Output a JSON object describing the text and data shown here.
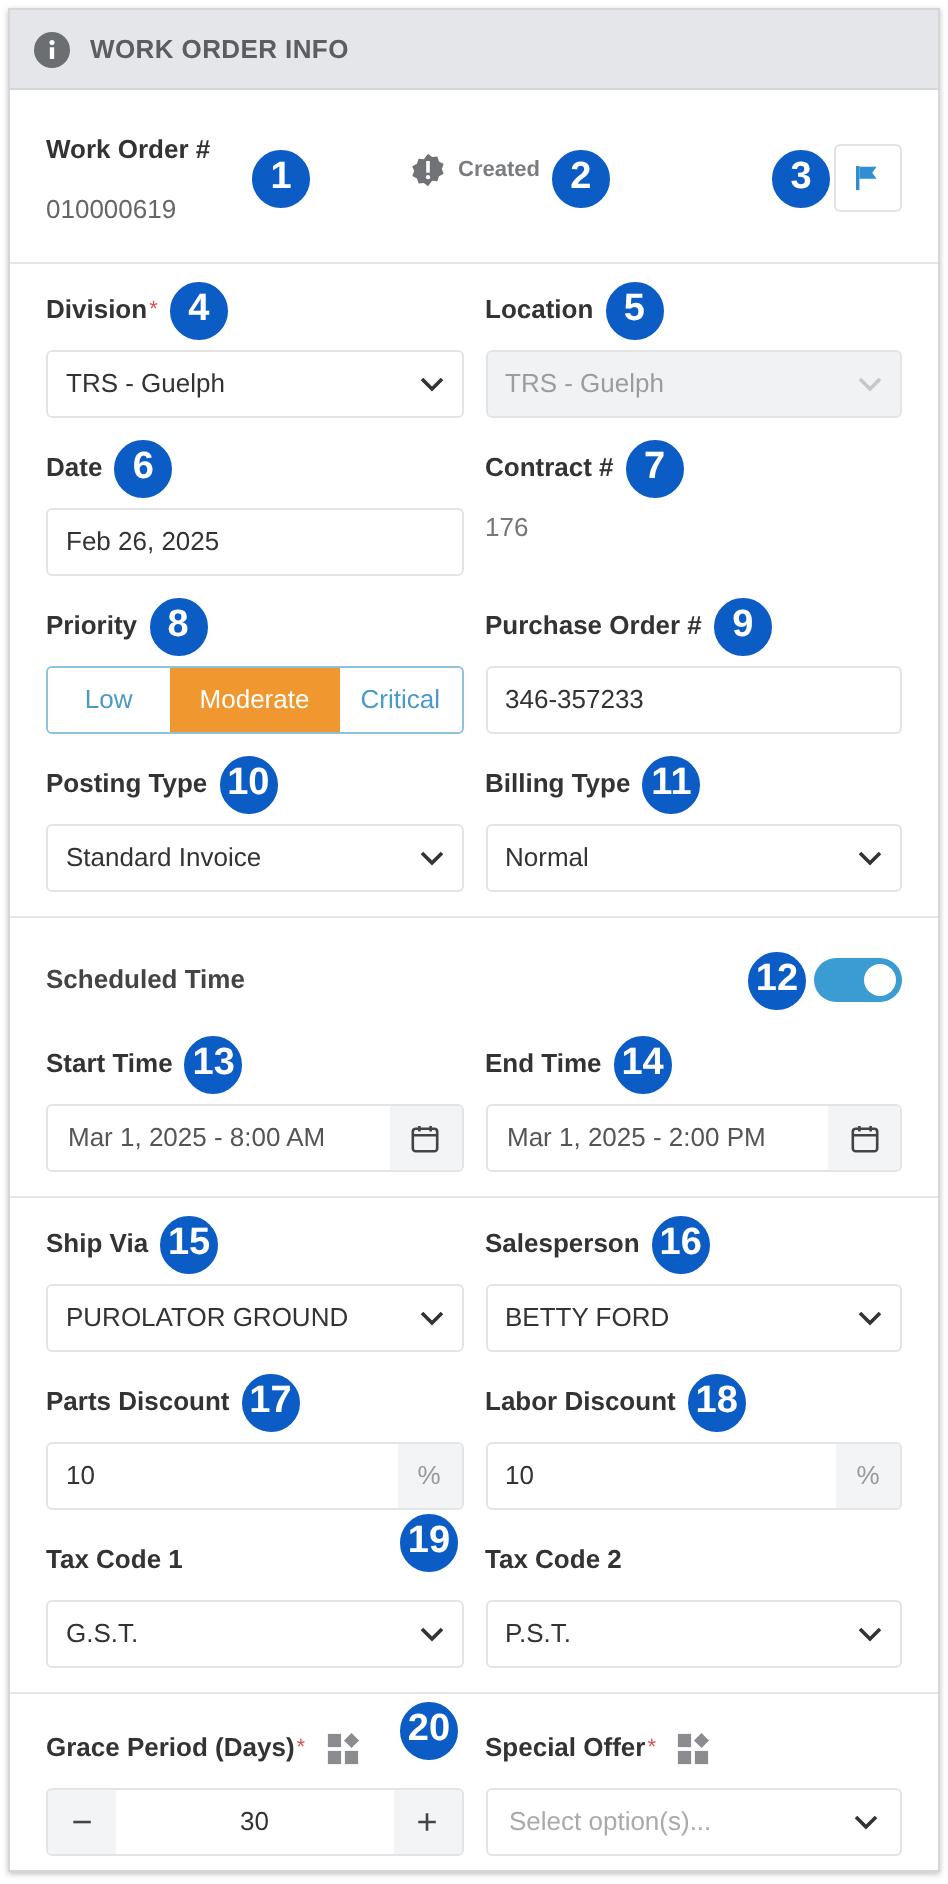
{
  "header": {
    "title": "WORK ORDER INFO"
  },
  "summary": {
    "label": "Work Order #",
    "value": "010000619",
    "callout": "1",
    "status": "Created",
    "status_callout": "2",
    "flag_callout": "3"
  },
  "sections": [
    {
      "rows": [
        [
          {
            "kind": "select",
            "label": "Division",
            "required_mark": "*",
            "value": "TRS - Guelph",
            "callout": "4"
          },
          {
            "kind": "select",
            "label": "Location",
            "value": "TRS - Guelph",
            "disabled": true,
            "callout": "5"
          }
        ],
        [
          {
            "kind": "text",
            "label": "Date",
            "value": "Feb 26, 2025",
            "callout": "6"
          },
          {
            "kind": "readonly",
            "label": "Contract #",
            "value": "176",
            "callout": "7"
          }
        ],
        [
          {
            "kind": "segmented",
            "label": "Priority",
            "callout": "8",
            "options": [
              {
                "label": "Low",
                "selected": false
              },
              {
                "label": "Moderate",
                "selected": true
              },
              {
                "label": "Critical",
                "selected": false
              }
            ]
          },
          {
            "kind": "text",
            "label": "Purchase Order #",
            "value": "346-357233",
            "callout": "9"
          }
        ],
        [
          {
            "kind": "select",
            "label": "Posting Type",
            "value": "Standard Invoice",
            "callout": "10"
          },
          {
            "kind": "select",
            "label": "Billing Type",
            "value": "Normal",
            "callout": "11"
          }
        ]
      ]
    },
    {
      "toggle": {
        "label": "Scheduled Time",
        "on": true,
        "callout": "12"
      },
      "rows": [
        [
          {
            "kind": "datetime",
            "label": "Start Time",
            "value": "Mar 1, 2025 - 8:00 AM",
            "callout": "13"
          },
          {
            "kind": "datetime",
            "label": "End Time",
            "value": "Mar 1, 2025 - 2:00 PM",
            "callout": "14"
          }
        ]
      ]
    },
    {
      "rows": [
        [
          {
            "kind": "select",
            "label": "Ship Via",
            "value": "PUROLATOR GROUND",
            "callout": "15"
          },
          {
            "kind": "select",
            "label": "Salesperson",
            "value": "BETTY FORD",
            "callout": "16"
          }
        ],
        [
          {
            "kind": "percent",
            "label": "Parts Discount",
            "value": "10",
            "unit": "%",
            "callout": "17"
          },
          {
            "kind": "percent",
            "label": "Labor Discount",
            "value": "10",
            "unit": "%",
            "callout": "18"
          }
        ],
        {
          "between_callout": "19",
          "fields": [
            {
              "kind": "select",
              "label": "Tax Code 1",
              "value": "G.S.T."
            },
            {
              "kind": "select",
              "label": "Tax Code 2",
              "value": "P.S.T."
            }
          ]
        }
      ]
    },
    {
      "rows": [
        {
          "between_callout": "20",
          "fields": [
            {
              "kind": "stepper",
              "label": "Grace Period (Days)",
              "required_mark": "*",
              "options_icon": true,
              "value": "30",
              "minus": "−",
              "plus": "+"
            },
            {
              "kind": "multiselect",
              "label": "Special Offer",
              "required_mark": "*",
              "options_icon": true,
              "placeholder": "Select option(s)..."
            }
          ]
        }
      ]
    }
  ]
}
